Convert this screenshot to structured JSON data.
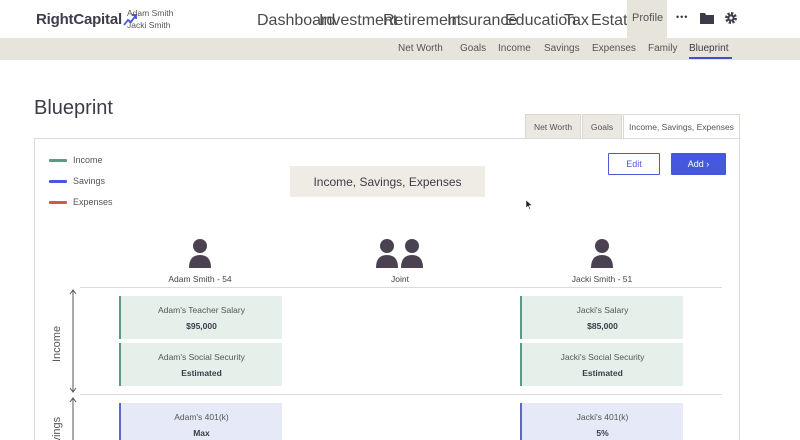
{
  "brand": {
    "name": "RightCapital"
  },
  "users": {
    "primary": "Adam Smith",
    "spouse": "Jacki Smith"
  },
  "nav": {
    "items": [
      "Dashboard",
      "Investment",
      "Retirement",
      "Insurance",
      "Education",
      "Tax",
      "Estate",
      "Profile"
    ],
    "more_label": "•••"
  },
  "subnav": {
    "items": [
      "Net Worth",
      "Goals",
      "Income",
      "Savings",
      "Expenses",
      "Family",
      "Blueprint"
    ],
    "active": "Blueprint"
  },
  "page": {
    "title": "Blueprint"
  },
  "view_tabs": [
    "Net Worth",
    "Goals",
    "Income, Savings, Expenses"
  ],
  "legend": [
    {
      "label": "Income",
      "color": "#5a9a82"
    },
    {
      "label": "Savings",
      "color": "#4558de"
    },
    {
      "label": "Expenses",
      "color": "#d9534f"
    }
  ],
  "center_label": "Income, Savings, Expenses",
  "buttons": {
    "edit": "Edit",
    "add": "Add ›"
  },
  "people": {
    "left": "Adam Smith - 54",
    "joint": "Joint",
    "right": "Jacki Smith - 51"
  },
  "sections": {
    "income": "Income",
    "savings": "Savings"
  },
  "cards": {
    "adam_salary": {
      "title": "Adam's Teacher Salary",
      "value": "$95,000"
    },
    "adam_ss": {
      "title": "Adam's Social Security",
      "value": "Estimated"
    },
    "jacki_salary": {
      "title": "Jacki's Salary",
      "value": "$85,000"
    },
    "jacki_ss": {
      "title": "Jacki's Social Security",
      "value": "Estimated"
    },
    "adam_401k": {
      "title": "Adam's 401(k)",
      "value": "Max"
    },
    "jacki_401k": {
      "title": "Jacki's 401(k)",
      "value": "5%"
    }
  }
}
